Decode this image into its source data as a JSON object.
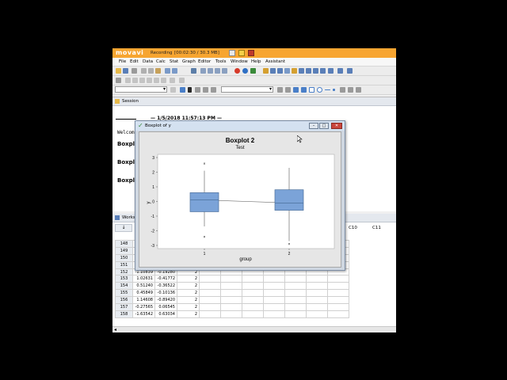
{
  "recorder": {
    "logo": "movavi",
    "label": "Recording",
    "time": "[00:02:30 / 30.3 MB]"
  },
  "menu": [
    "File",
    "Edit",
    "Data",
    "Calc",
    "Stat",
    "Graph",
    "Editor",
    "Tools",
    "Window",
    "Help",
    "Assistant"
  ],
  "session": {
    "title": "Session",
    "header_partial": "— 1/5/2018 11:57:13 PM —",
    "welcome": "Welcome",
    "boxplot_lines": [
      "Boxpl",
      "Boxpl",
      "Boxpl"
    ]
  },
  "worksheet": {
    "title": "Works",
    "header_cells": [
      "C10",
      "C11"
    ],
    "rows": [
      {
        "n": "148",
        "c1": "",
        "c2": "",
        "c3": ""
      },
      {
        "n": "149",
        "c1": "",
        "c2": "",
        "c3": ""
      },
      {
        "n": "150",
        "c1": "",
        "c2": "",
        "c3": ""
      },
      {
        "n": "151",
        "c1": "",
        "c2": "",
        "c3": ""
      },
      {
        "n": "152",
        "c1": "-1.10839",
        "c2": "-0.19280",
        "c3": "2"
      },
      {
        "n": "153",
        "c1": "1.02631",
        "c2": "-0.41772",
        "c3": "2"
      },
      {
        "n": "154",
        "c1": "0.51240",
        "c2": "-0.36522",
        "c3": "2"
      },
      {
        "n": "155",
        "c1": "0.45849",
        "c2": "-0.10136",
        "c3": "2"
      },
      {
        "n": "156",
        "c1": "1.14608",
        "c2": "-0.89420",
        "c3": "2"
      },
      {
        "n": "157",
        "c1": "-0.27565",
        "c2": "0.06545",
        "c3": "2"
      },
      {
        "n": "158",
        "c1": "-1.63542",
        "c2": "0.63034",
        "c3": "2"
      }
    ]
  },
  "dialog": {
    "title": "Boxplot of y"
  },
  "colors": {
    "box_fill": "#7ba3d8",
    "box_stroke": "#4a6f9c",
    "recorder_bar": "#f7a531"
  },
  "chart_data": {
    "type": "boxplot",
    "title": "Boxplot 2",
    "subtitle": "Test",
    "xlabel": "group",
    "ylabel": "y",
    "ylim": [
      -3,
      3
    ],
    "yticks": [
      "3",
      "2",
      "1",
      "0",
      "-1",
      "-2",
      "-3"
    ],
    "categories": [
      "1",
      "2"
    ],
    "boxes": [
      {
        "category": "1",
        "whisker_low": -1.7,
        "q1": -0.7,
        "median": 0.1,
        "q3": 0.6,
        "whisker_high": 2.1,
        "outliers": [
          2.6,
          -2.4
        ]
      },
      {
        "category": "2",
        "whisker_low": -2.7,
        "q1": -0.6,
        "median": -0.1,
        "q3": 0.8,
        "whisker_high": 2.3,
        "outliers": [
          -2.9
        ]
      }
    ],
    "mean_connect_line": true,
    "grid": false,
    "legend": "none"
  }
}
